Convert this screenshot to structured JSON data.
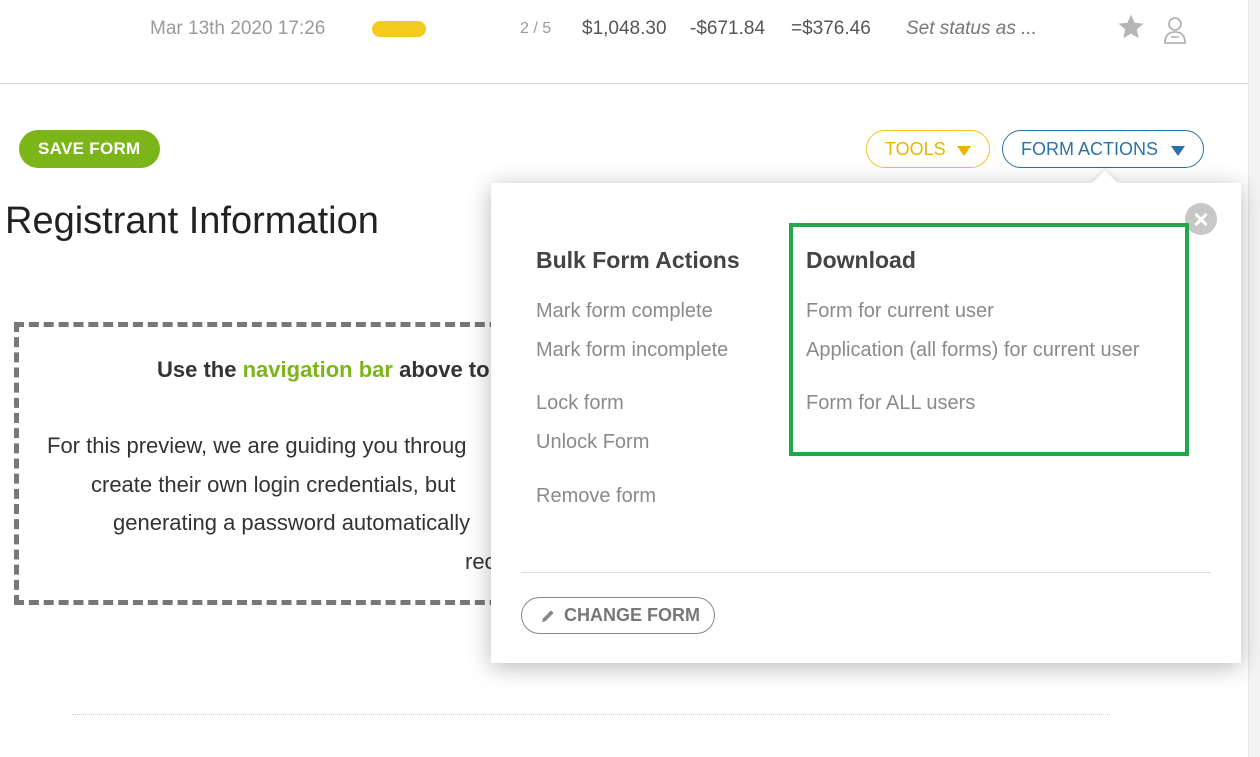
{
  "summary_row": {
    "date": "Mar 13th 2020 17:26",
    "status_color": "#f2cb1d",
    "steps": "2 / 5",
    "amount_total": "$1,048.30",
    "amount_paid": "-$671.84",
    "amount_balance": "=$376.46",
    "set_status": "Set status as ...",
    "icons": [
      "star-icon",
      "user-icon"
    ]
  },
  "toolbar": {
    "save_label": "SAVE FORM",
    "tools_label": "TOOLS",
    "form_actions_label": "FORM ACTIONS"
  },
  "page": {
    "title": "Registrant Information"
  },
  "info_box": {
    "head_prefix": "Use the",
    "head_link": "navigation bar",
    "head_suffix": "above to",
    "line1": "For this preview, we are guiding you throug",
    "line2": "create their own login credentials, but",
    "line3": "generating a password automatically",
    "line4": "rec"
  },
  "form_actions_panel": {
    "bulk": {
      "title": "Bulk Form Actions",
      "items": [
        "Mark form complete",
        "Mark form incomplete",
        "Lock form",
        "Unlock Form",
        "Remove form"
      ]
    },
    "download": {
      "title": "Download",
      "items": [
        "Form for current user",
        "Application (all forms) for current user",
        "Form for ALL users"
      ]
    },
    "change_form_label": "CHANGE FORM",
    "colors": {
      "highlight": "#22a84a",
      "save": "#7cb518",
      "tools": "#e8b400",
      "actions": "#2b72a7"
    }
  }
}
